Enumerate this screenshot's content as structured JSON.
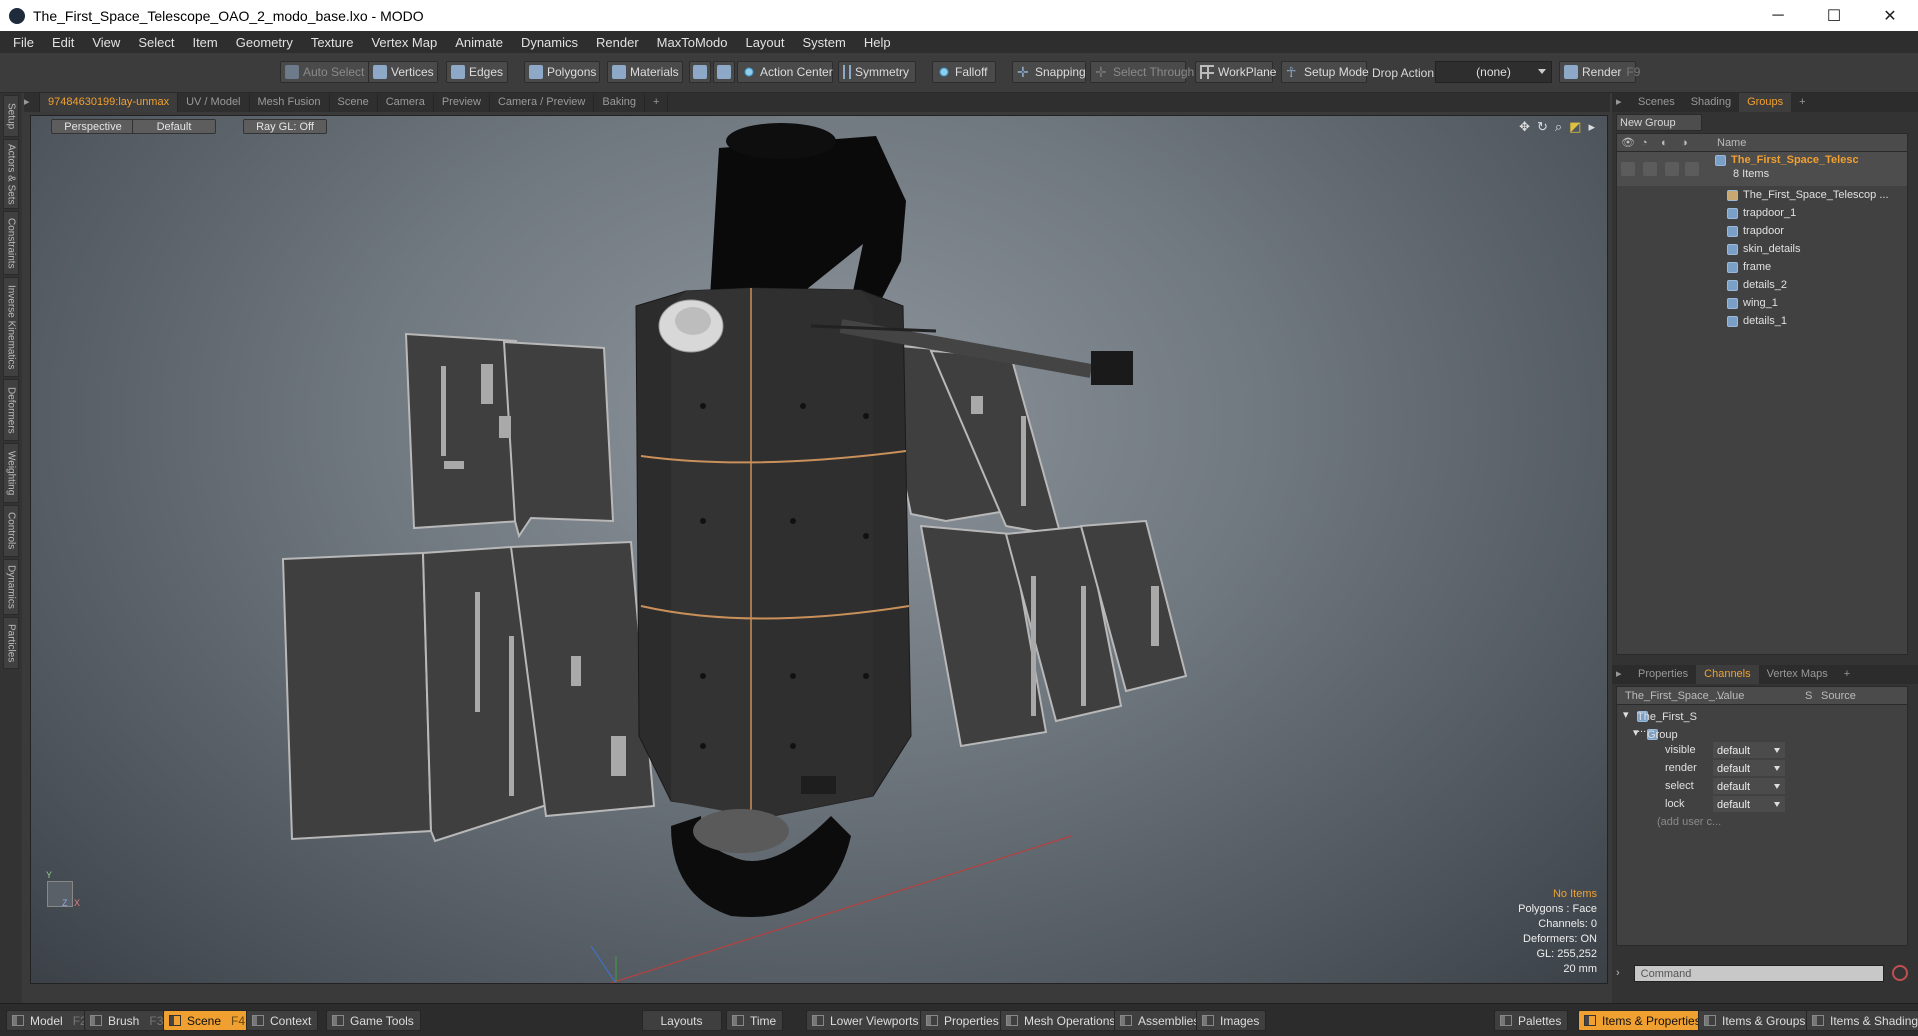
{
  "window": {
    "title": "The_First_Space_Telescope_OAO_2_modo_base.lxo - MODO",
    "minimize": "─",
    "maximize": "☐",
    "close": "✕"
  },
  "menu": [
    "File",
    "Edit",
    "View",
    "Select",
    "Item",
    "Geometry",
    "Texture",
    "Vertex Map",
    "Animate",
    "Dynamics",
    "Render",
    "MaxToModo",
    "Layout",
    "System",
    "Help"
  ],
  "toolbar": {
    "auto_select": "Auto Select",
    "vertices": "Vertices",
    "edges": "Edges",
    "polygons": "Polygons",
    "materials": "Materials",
    "action_center": "Action Center",
    "symmetry": "Symmetry",
    "falloff": "Falloff",
    "snapping": "Snapping",
    "select_through": "Select Through",
    "workplane": "WorkPlane",
    "setup_mode": "Setup Mode",
    "drop_action_label": "Drop Action",
    "drop_action_value": "(none)",
    "render": "Render",
    "render_key": "F9"
  },
  "left_tabs": [
    "Setup",
    "Actors & Sets",
    "Constraints",
    "Inverse Kinematics",
    "Deformers",
    "Weighting",
    "Controls",
    "Dynamics",
    "Particles"
  ],
  "viewport_tabs": [
    "97484630199:lay-unmax",
    "UV / Model",
    "Mesh Fusion",
    "Scene",
    "Camera",
    "Preview",
    "Camera / Preview",
    "Baking",
    "+"
  ],
  "viewport": {
    "view_mode": "Perspective",
    "shading": "Default",
    "raygl": "Ray GL: Off",
    "info": {
      "selection": "No Items",
      "polygons": "Polygons : Face",
      "channels": "Channels: 0",
      "deformers": "Deformers: ON",
      "gl": "GL: 255,252",
      "scale": "20 mm"
    },
    "axis_x": "X",
    "axis_y": "Y",
    "axis_z": "Z"
  },
  "right_tabs_top": [
    "Scenes",
    "Shading",
    "Groups",
    "+"
  ],
  "groups": {
    "new_group": "New Group",
    "name_header": "Name",
    "root_name": "The_First_Space_Telesc",
    "root_count": "8 Items",
    "items": [
      "The_First_Space_Telescop ...",
      "trapdoor_1",
      "trapdoor",
      "skin_details",
      "frame",
      "details_2",
      "wing_1",
      "details_1"
    ]
  },
  "right_tabs_bottom": [
    "Properties",
    "Channels",
    "Vertex Maps",
    "+"
  ],
  "channels": {
    "col_name": "The_First_Space_...",
    "col_value": "Value",
    "col_s": "S",
    "col_source": "Source",
    "item": "The_First_S ...",
    "group": "Group",
    "rows": [
      {
        "name": "visible",
        "value": "default"
      },
      {
        "name": "render",
        "value": "default"
      },
      {
        "name": "select",
        "value": "default"
      },
      {
        "name": "lock",
        "value": "default"
      }
    ],
    "add_user": "(add user c..."
  },
  "command_placeholder": "Command",
  "bottom": {
    "model": "Model",
    "model_key": "F2",
    "brush": "Brush",
    "brush_key": "F3",
    "scene": "Scene",
    "scene_key": "F4",
    "context": "Context",
    "game_tools": "Game Tools",
    "layouts": "Layouts",
    "time": "Time",
    "lower_viewports": "Lower Viewports",
    "properties": "Properties",
    "mesh_operations": "Mesh Operations",
    "assemblies": "Assemblies",
    "images": "Images",
    "palettes": "Palettes",
    "items_properties": "Items & Properties",
    "items_groups": "Items & Groups",
    "items_shading": "Items & Shading"
  },
  "colors": {
    "accent": "#f0a030",
    "background": "#3a3a3a"
  }
}
